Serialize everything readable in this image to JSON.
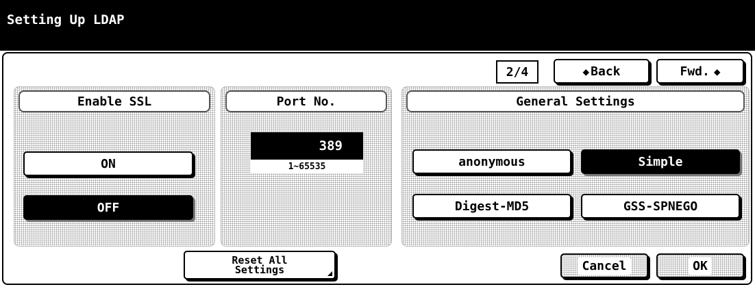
{
  "title": "Setting Up LDAP",
  "pager": {
    "page": "2/4",
    "back_label": "Back",
    "fwd_label": "Fwd."
  },
  "ssl": {
    "header": "Enable SSL",
    "on_label": "ON",
    "off_label": "OFF",
    "selected": "OFF"
  },
  "port": {
    "header": "Port No.",
    "value": "389",
    "range": "1~65535"
  },
  "general": {
    "header": "General Settings",
    "options": [
      "anonymous",
      "Simple",
      "Digest-MD5",
      "GSS-SPNEGO"
    ],
    "selected": "Simple"
  },
  "footer": {
    "reset_line1": "Reset All",
    "reset_line2": "Settings",
    "cancel_label": "Cancel",
    "ok_label": "OK"
  },
  "colors": {
    "selected_bg": "#000000",
    "background": "#ffffff",
    "dot_pattern": "#9a9a9a"
  }
}
